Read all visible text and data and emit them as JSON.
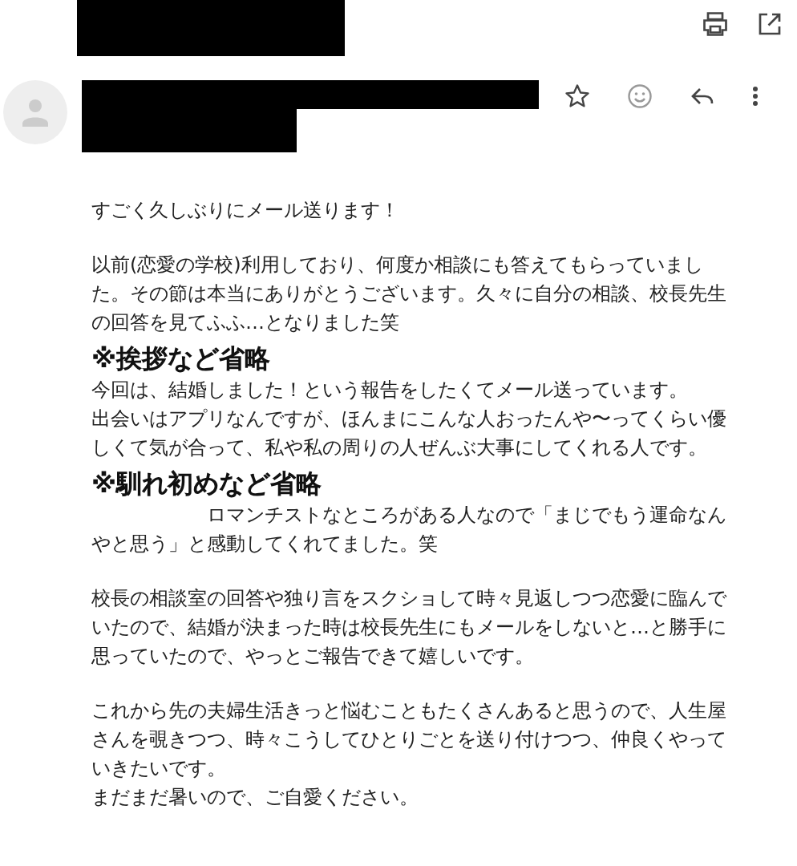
{
  "sections": [
    {
      "blocks": [
        {
          "kind": "text",
          "text": "すごく久しぶりにメール送ります！"
        }
      ]
    },
    {
      "blocks": [
        {
          "kind": "text",
          "text": "以前(恋愛の学校)利用しており、何度か相談にも答えてもらっていました。その節は本当にありがとうございます。久々に自分の相談、校長先生の回答を見てふふ…となりました笑"
        },
        {
          "kind": "heading",
          "text": "※挨拶など省略"
        },
        {
          "kind": "text",
          "text": "今回は、結婚しました！という報告をしたくてメール送っています。"
        },
        {
          "kind": "text",
          "text": "出会いはアプリなんですが、ほんまにこんな人おったんや〜ってくらい優しくて気が合って、私や私の周りの人ぜんぶ大事にしてくれる人です。"
        },
        {
          "kind": "heading",
          "text": "※馴れ初めなど省略"
        },
        {
          "kind": "text",
          "text": "　　　　　　ロマンチストなところがある人なので「まじでもう運命なんやと思う」と感動してくれてました。笑"
        }
      ]
    },
    {
      "blocks": [
        {
          "kind": "text",
          "text": "校長の相談室の回答や独り言をスクショして時々見返しつつ恋愛に臨んでいたので、結婚が決まった時は校長先生にもメールをしないと…と勝手に思っていたので、やっとご報告できて嬉しいです。"
        }
      ]
    },
    {
      "blocks": [
        {
          "kind": "text",
          "text": "これから先の夫婦生活きっと悩むこともたくさんあると思うので、人生屋さんを覗きつつ、時々こうしてひとりごとを送り付けつつ、仲良くやっていきたいです。"
        },
        {
          "kind": "text",
          "text": "まだまだ暑いので、ご自愛ください。"
        }
      ]
    }
  ]
}
